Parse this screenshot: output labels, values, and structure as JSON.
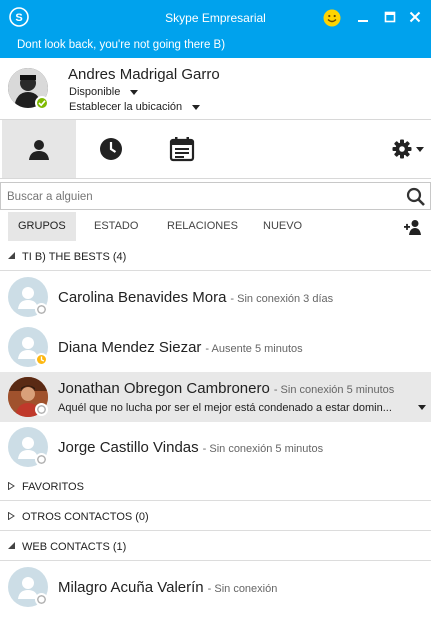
{
  "window": {
    "title": "Skype Empresarial",
    "colors": {
      "accent": "#00a2ed",
      "available": "#7fba00",
      "away": "#fdb813"
    }
  },
  "banner": {
    "note": "Dont look back, you're not going there B)"
  },
  "profile": {
    "name": "Andres Madrigal Garro",
    "status": "Disponible",
    "location": "Establecer la ubicación"
  },
  "toolbar": {
    "icons": [
      "contacts-icon",
      "history-icon",
      "meetings-icon",
      "gear-icon"
    ]
  },
  "search": {
    "placeholder": "Buscar a alguien",
    "value": ""
  },
  "filters": {
    "tabs": [
      {
        "label": "GRUPOS"
      },
      {
        "label": "ESTADO"
      },
      {
        "label": "RELACIONES"
      },
      {
        "label": "NUEVO"
      }
    ]
  },
  "groups": [
    {
      "label": "TI  B)  THE BESTS (4)",
      "expanded": true,
      "contacts": [
        {
          "name": "Carolina Benavides Mora",
          "status": "- Sin conexión 3 días",
          "presence": "offline"
        },
        {
          "name": "Diana Mendez Siezar",
          "status": "- Ausente 5 minutos",
          "presence": "away"
        },
        {
          "name": "Jonathan Obregon Cambronero",
          "status": "- Sin conexión 5 minutos",
          "presence": "offline",
          "note": "Aquél que no lucha por ser el mejor está condenado a estar domin..."
        },
        {
          "name": "Jorge Castillo Vindas",
          "status": "- Sin conexión 5 minutos",
          "presence": "offline"
        }
      ]
    },
    {
      "label": "FAVORITOS",
      "expanded": false
    },
    {
      "label": "OTROS CONTACTOS (0)",
      "expanded": false
    },
    {
      "label": "WEB CONTACTS (1)",
      "expanded": true,
      "contacts": [
        {
          "name": "Milagro Acuña Valerín",
          "status": "- Sin conexión",
          "presence": "offline"
        }
      ]
    }
  ]
}
